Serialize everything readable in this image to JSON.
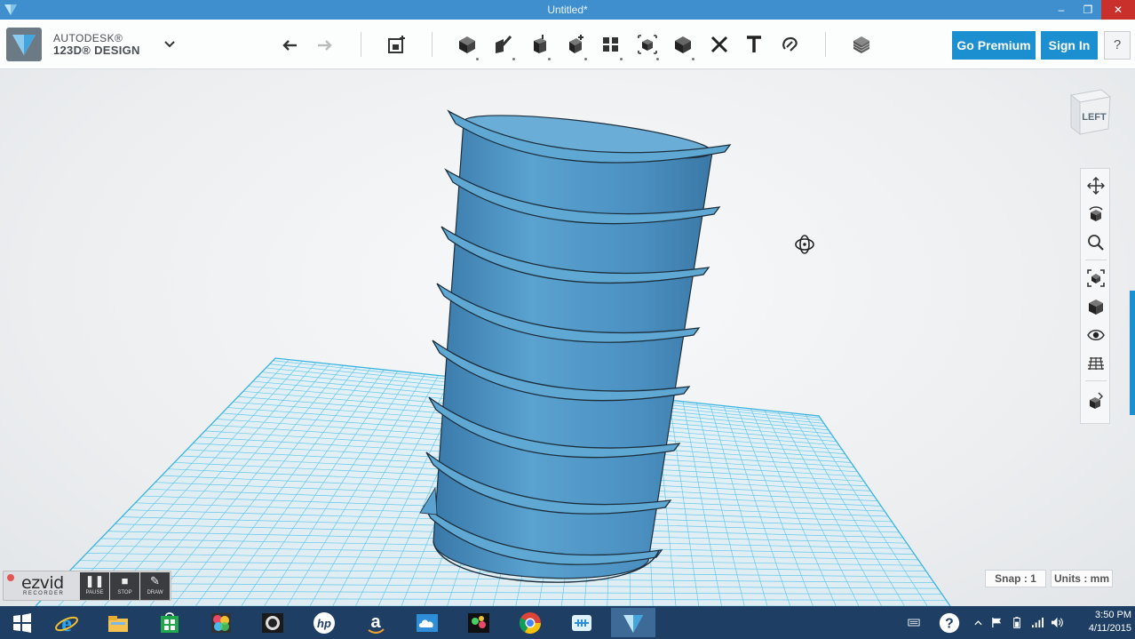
{
  "window": {
    "title": "Untitled*",
    "minimize": "–",
    "maximize": "❐",
    "close": "✕"
  },
  "brand": {
    "line1": "AUTODESK®",
    "line2": "123D® DESIGN",
    "dropdown": "⌄"
  },
  "toolbar": {
    "tools": [
      "undo-icon",
      "redo-icon",
      "primitives-icon",
      "sketch-icon",
      "construct-icon",
      "modify-icon",
      "pattern-icon",
      "group-icon",
      "combine-icon",
      "measure-icon",
      "text-icon",
      "snap-icon",
      "material-icon"
    ],
    "go_premium": "Go Premium",
    "sign_in": "Sign In",
    "help": "?"
  },
  "colors": {
    "titlebar": "#3f8fcf",
    "accent": "#1b8fd0",
    "model": "#4a8fc0",
    "grid": "#58c3e8",
    "taskbar": "#1e3f63"
  },
  "viewcube": {
    "face_label": "LEFT"
  },
  "nav_panel": {
    "items": [
      "pan-icon",
      "orbit-icon",
      "zoom-icon",
      "fit-icon",
      "view-cube-icon",
      "visibility-icon",
      "grid-icon",
      "material-view-icon"
    ]
  },
  "status": {
    "snap": "Snap : 1",
    "units": "Units : mm"
  },
  "ezvid": {
    "logo": "ezvid",
    "subtitle": "RECORDER",
    "pause": "PAUSE",
    "stop": "STOP",
    "draw": "DRAW"
  },
  "taskbar": {
    "apps": [
      "windows-start-icon",
      "internet-explorer-icon",
      "file-explorer-icon",
      "store-icon",
      "photos-icon",
      "camera-icon",
      "hp-icon",
      "amazon-icon",
      "cloud-icon",
      "media-icon",
      "chrome-icon",
      "network-app-icon",
      "123d-design-icon"
    ],
    "clock_time": "3:50 PM",
    "clock_date": "4/11/2015",
    "help": "?"
  }
}
